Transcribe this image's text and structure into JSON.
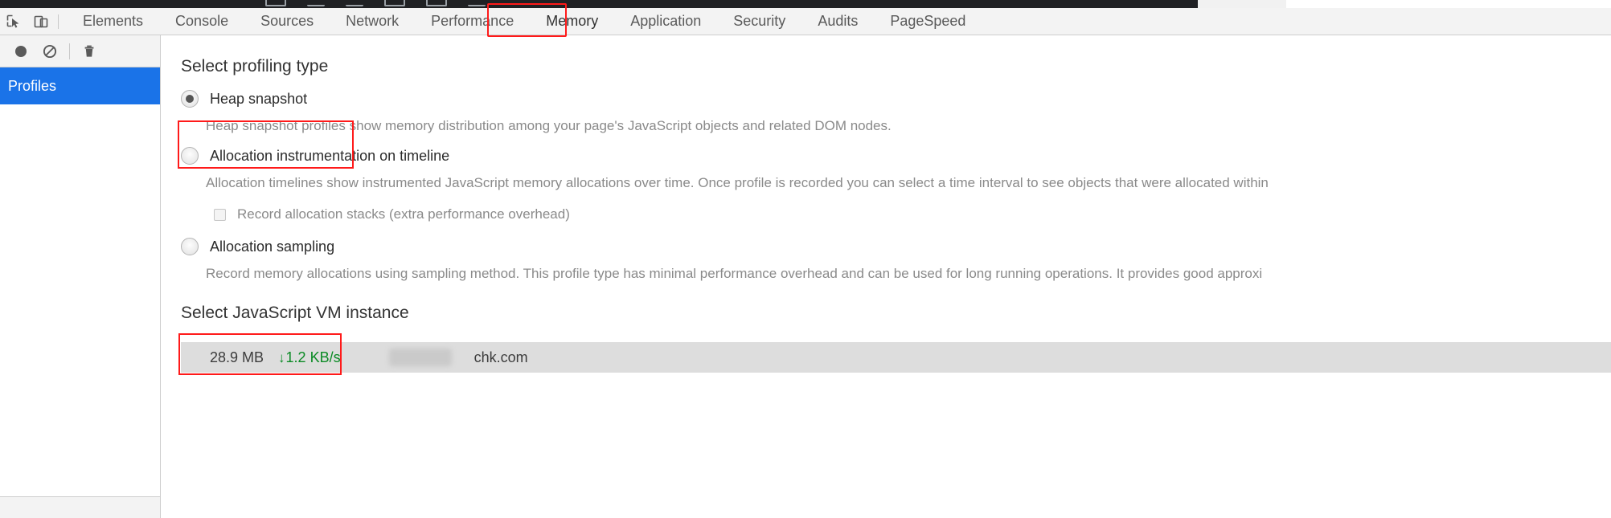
{
  "browser_chrome": {
    "description": "cut-off browser toolbar strip"
  },
  "devtools": {
    "toolbar_icons": [
      {
        "name": "inspect-element-icon",
        "label": "Inspect element"
      },
      {
        "name": "device-toolbar-icon",
        "label": "Toggle device toolbar"
      }
    ],
    "tabs": [
      {
        "label": "Elements",
        "active": false,
        "highlighted": false
      },
      {
        "label": "Console",
        "active": false,
        "highlighted": false
      },
      {
        "label": "Sources",
        "active": false,
        "highlighted": false
      },
      {
        "label": "Network",
        "active": false,
        "highlighted": false
      },
      {
        "label": "Performance",
        "active": false,
        "highlighted": false
      },
      {
        "label": "Memory",
        "active": true,
        "highlighted": true
      },
      {
        "label": "Application",
        "active": false,
        "highlighted": false
      },
      {
        "label": "Security",
        "active": false,
        "highlighted": false
      },
      {
        "label": "Audits",
        "active": false,
        "highlighted": false
      },
      {
        "label": "PageSpeed",
        "active": false,
        "highlighted": false
      }
    ]
  },
  "sidebar": {
    "toolbar_buttons": [
      {
        "name": "record-button",
        "label": "Start recording heap profile"
      },
      {
        "name": "clear-button",
        "label": "Clear all profiles"
      },
      {
        "name": "delete-button",
        "label": "Delete profile"
      }
    ],
    "items": [
      {
        "label": "Profiles",
        "selected": true
      }
    ]
  },
  "main": {
    "profiling_type": {
      "heading": "Select profiling type",
      "options": [
        {
          "id": "heap-snapshot",
          "label": "Heap snapshot",
          "selected": true,
          "description": "Heap snapshot profiles show memory distribution among your page's JavaScript objects and related DOM nodes."
        },
        {
          "id": "allocation-instrumentation-on-timeline",
          "label": "Allocation instrumentation on timeline",
          "selected": false,
          "description": "Allocation timelines show instrumented JavaScript memory allocations over time. Once profile is recorded you can select a time interval to see objects that were allocated within",
          "sub_option": {
            "id": "record-allocation-stacks",
            "label": "Record allocation stacks (extra performance overhead)",
            "checked": false
          }
        },
        {
          "id": "allocation-sampling",
          "label": "Allocation sampling",
          "selected": false,
          "description": "Record memory allocations using sampling method. This profile type has minimal performance overhead and can be used for long running operations. It provides good approxi"
        }
      ]
    },
    "vm_instance": {
      "heading": "Select JavaScript VM instance",
      "rows": [
        {
          "size": "28.9 MB",
          "rate_arrow": "↓",
          "rate": "1.2 KB/s",
          "rate_color": "#0a8a24",
          "redacted": true,
          "domain": "chk.com"
        }
      ]
    }
  },
  "annotations": {
    "color": "#ff1a1a",
    "boxes": [
      {
        "name": "memory-tab-highlight",
        "target": "Memory"
      },
      {
        "name": "heap-snapshot-highlight",
        "target": "Heap snapshot"
      },
      {
        "name": "vm-instance-highlight",
        "target": "28.9 MB 1.2 KB/s"
      }
    ]
  }
}
